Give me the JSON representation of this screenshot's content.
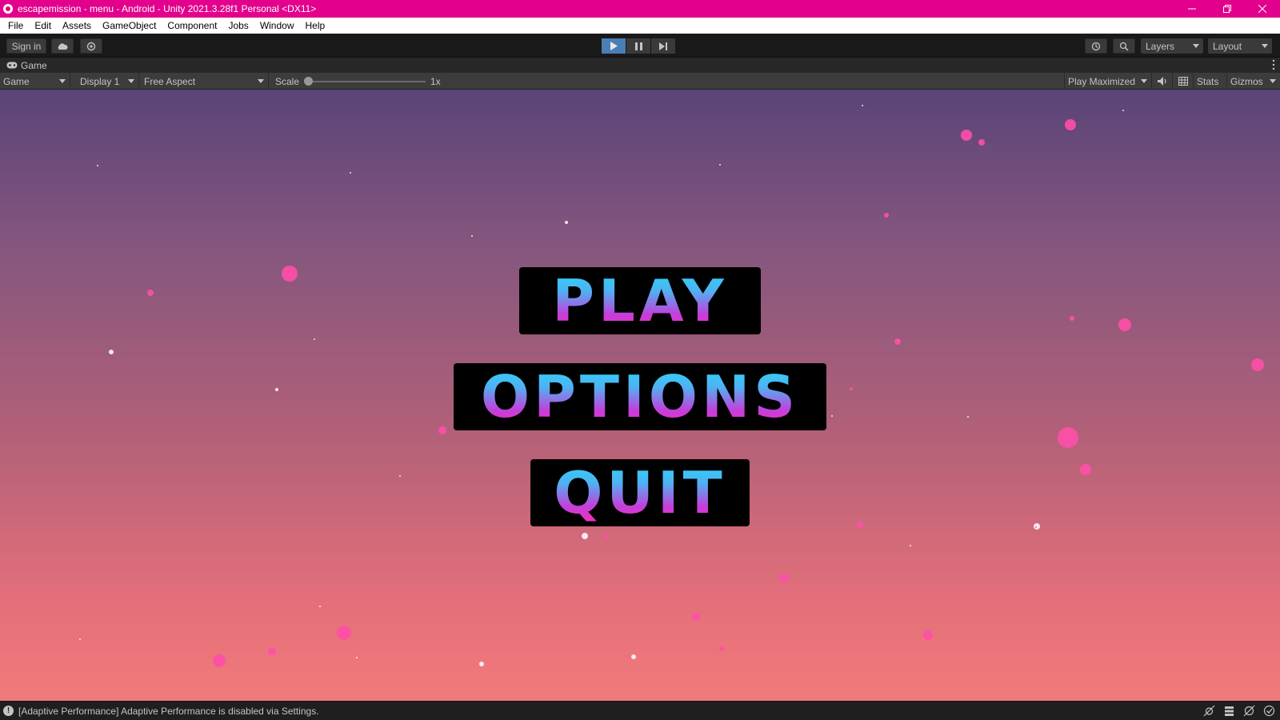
{
  "window": {
    "title": "escapemission - menu - Android - Unity 2021.3.28f1 Personal <DX11>"
  },
  "menubar": {
    "items": [
      "File",
      "Edit",
      "Assets",
      "GameObject",
      "Component",
      "Jobs",
      "Window",
      "Help"
    ]
  },
  "toolbar": {
    "sign_in": "Sign in",
    "layers": "Layers",
    "layout": "Layout",
    "play_active": true
  },
  "tab": {
    "label": "Game"
  },
  "gamebar": {
    "mode": "Game",
    "display": "Display 1",
    "aspect": "Free Aspect",
    "scale_label": "Scale",
    "scale_value": "1x",
    "play_mode": "Play Maximized",
    "stats": "Stats",
    "gizmos": "Gizmos"
  },
  "game_menu": {
    "play": "PLAY",
    "options": "OPTIONS",
    "quit": "QUIT"
  },
  "status": {
    "message": "[Adaptive Performance] Adaptive Performance is disabled via Settings."
  },
  "colors": {
    "titlebar": "#e3008c",
    "play_active": "#4a7fb5",
    "particle_pink": "#ff4fa8",
    "button_text_top": "#2ad8f5",
    "button_text_bottom": "#ff2bb0"
  }
}
